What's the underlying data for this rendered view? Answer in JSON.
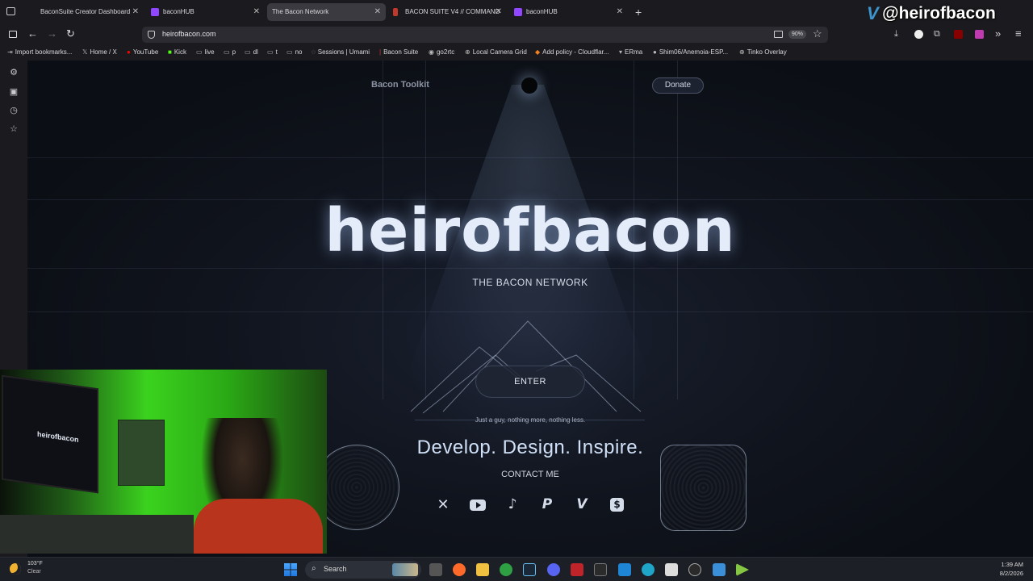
{
  "tabs": [
    {
      "label": "BaconSuite Creator Dashboard",
      "active": false
    },
    {
      "label": "baconHUB",
      "active": false
    },
    {
      "label": "The Bacon Network",
      "active": true
    },
    {
      "label": "BACON SUITE V4 // COMMAND",
      "active": false
    },
    {
      "label": "baconHUB",
      "active": false
    }
  ],
  "overlay_handle": "@heirofbacon",
  "url": "heirofbacon.com",
  "zoom": "90%",
  "bookmarks": [
    "Import bookmarks...",
    "Home / X",
    "YouTube",
    "Kick",
    "live",
    "p",
    "dl",
    "t",
    "no",
    "Sessions | Umami",
    "Bacon Suite",
    "go2rtc",
    "Local Camera Grid",
    "Add policy - Cloudflar...",
    "ERma",
    "Shim06/Anemoia-ESP...",
    "Tinko Overlay"
  ],
  "site": {
    "nav_left": "Bacon Toolkit",
    "donate": "Donate",
    "title": "heirofbacon",
    "subtitle": "THE BACON NETWORK",
    "enter": "ENTER",
    "tagline": "Just a guy, nothing more, nothing less.",
    "headline": "Develop. Design. Inspire.",
    "contact": "CONTACT ME"
  },
  "socials": [
    "x-icon",
    "youtube-icon",
    "tiktok-icon",
    "paypal-icon",
    "venmo-icon",
    "cashapp-icon"
  ],
  "webcam": {
    "screen_text": "heirofbacon"
  },
  "taskbar": {
    "weather_temp": "103°F",
    "weather_desc": "Clear",
    "search": "Search",
    "time": "1:39 AM",
    "date": "8/2/2026"
  }
}
